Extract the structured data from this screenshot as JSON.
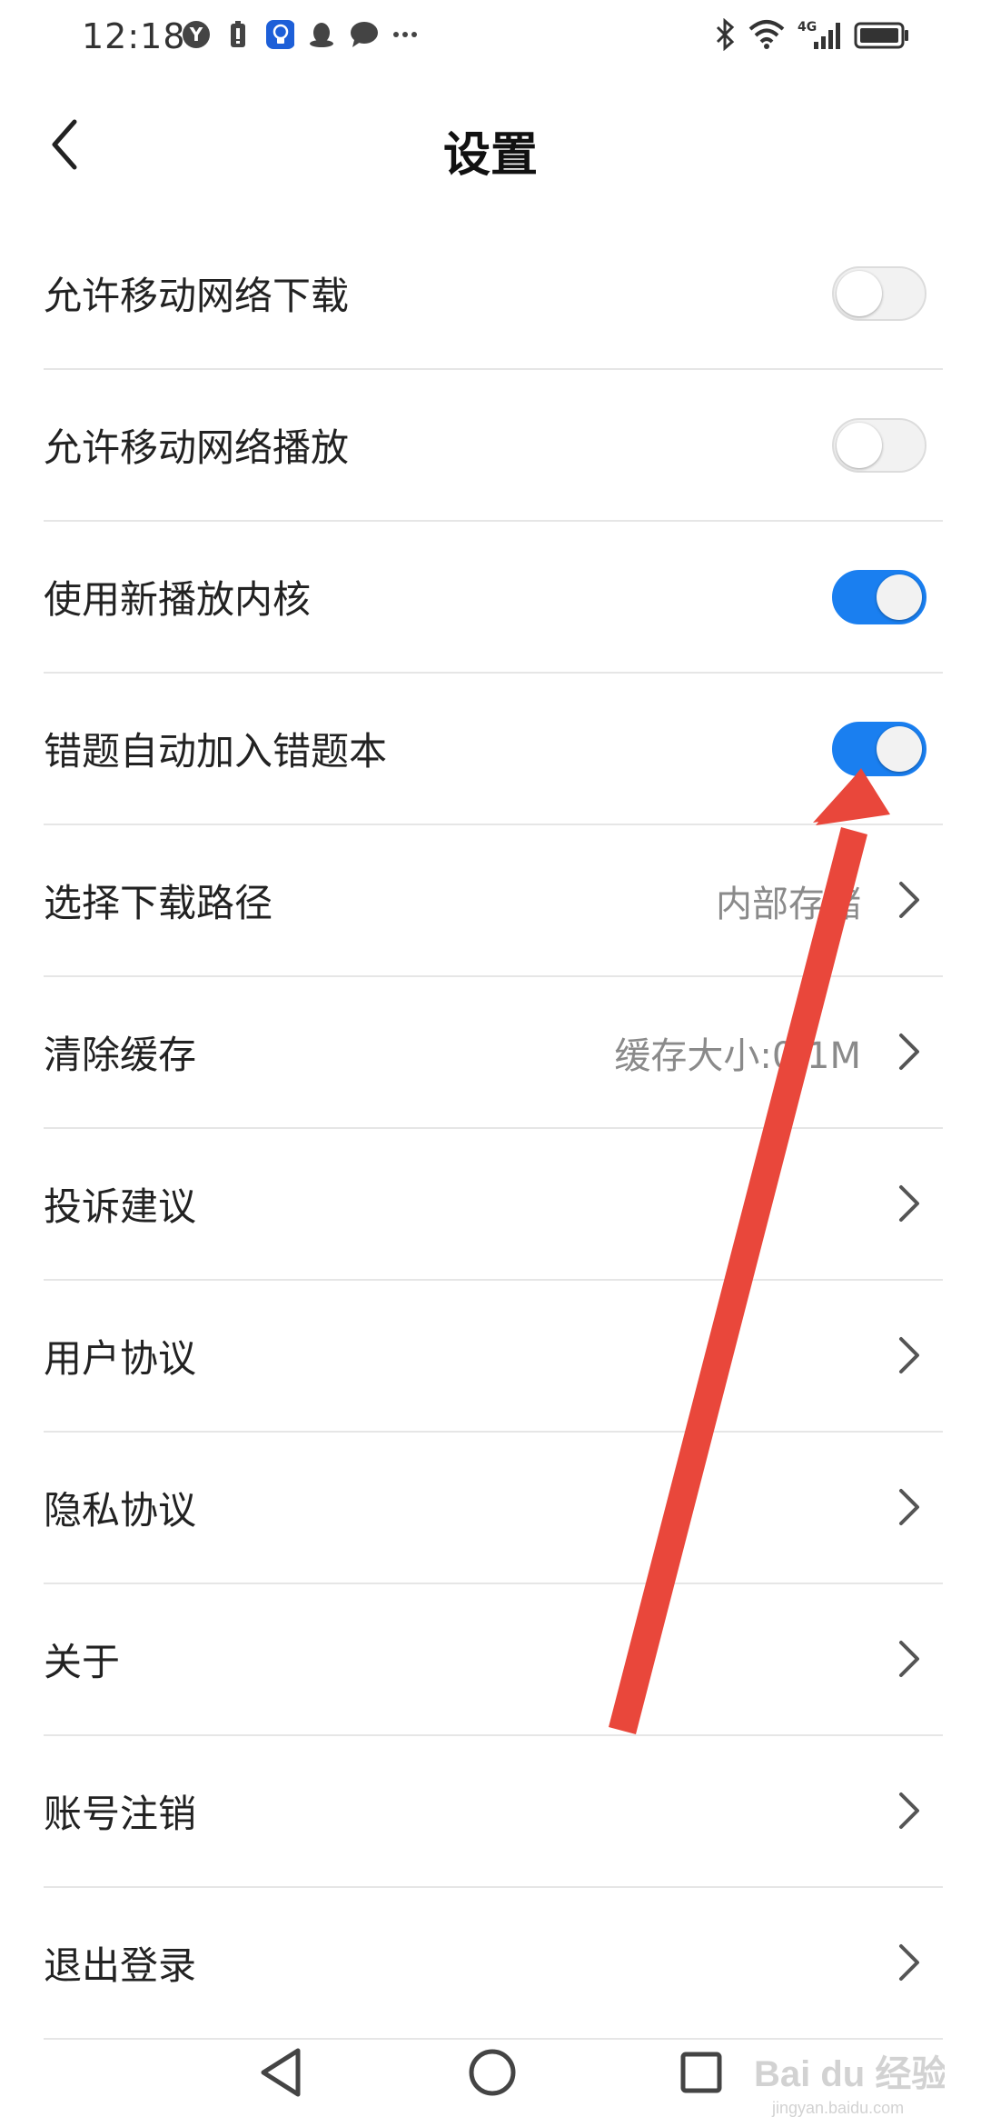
{
  "status_bar": {
    "time": "12:18",
    "left_icons": [
      "y-app-icon",
      "battery-saver-icon",
      "bulb-app-icon",
      "qq-icon",
      "message-icon",
      "more-dots-icon"
    ],
    "right_icons": [
      "bluetooth-icon",
      "wifi-icon",
      "signal-4g-icon",
      "battery-icon"
    ]
  },
  "header": {
    "title": "设置"
  },
  "settings": {
    "toggles": [
      {
        "label": "允许移动网络下载",
        "on": false
      },
      {
        "label": "允许移动网络播放",
        "on": false
      },
      {
        "label": "使用新播放内核",
        "on": true
      },
      {
        "label": "错题自动加入错题本",
        "on": true
      }
    ],
    "items": [
      {
        "label": "选择下载路径",
        "value": "内部存储"
      },
      {
        "label": "清除缓存",
        "value": "缓存大小:0.1M"
      },
      {
        "label": "投诉建议",
        "value": ""
      },
      {
        "label": "用户协议",
        "value": ""
      },
      {
        "label": "隐私协议",
        "value": ""
      },
      {
        "label": "关于",
        "value": ""
      },
      {
        "label": "账号注销",
        "value": ""
      },
      {
        "label": "退出登录",
        "value": ""
      }
    ]
  },
  "nav_bar": {
    "buttons": [
      "back-triangle-icon",
      "home-circle-icon",
      "recents-square-icon"
    ]
  },
  "watermark": {
    "text": "Bai du 经验",
    "sub": "jingyan.baidu.com"
  },
  "colors": {
    "toggle_on": "#1a7ff0",
    "annotation_arrow": "#e9473b"
  }
}
